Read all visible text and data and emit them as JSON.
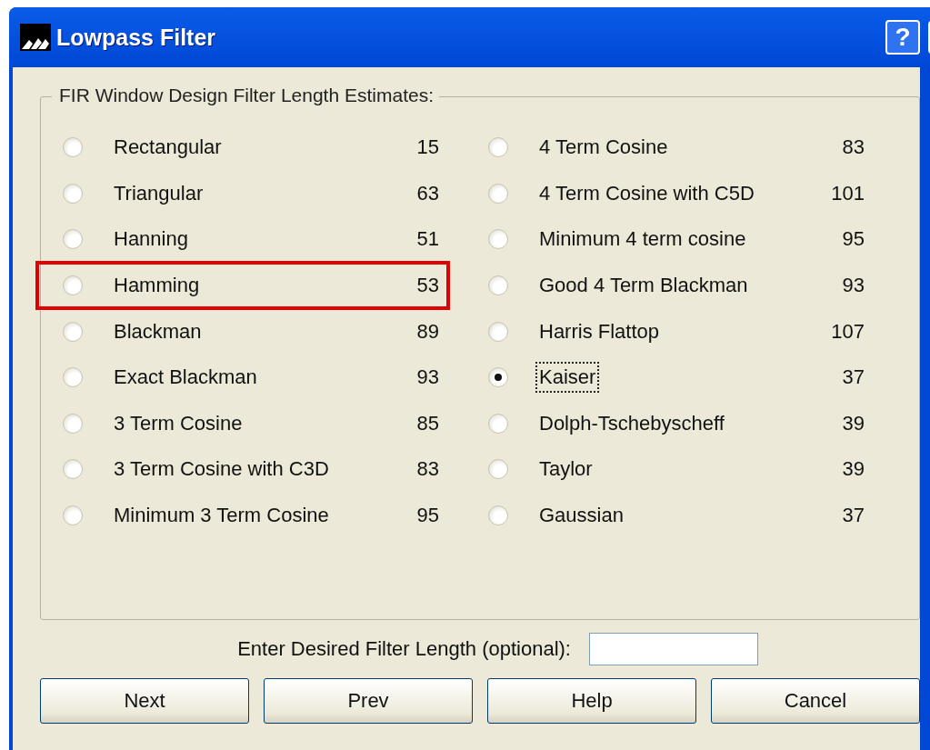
{
  "window": {
    "title": "Lowpass Filter",
    "help_button": "?"
  },
  "group": {
    "title": "FIR Window Design Filter Length Estimates:"
  },
  "windows": [
    {
      "label": "Rectangular",
      "estimate": "15",
      "selected": false,
      "focused": false,
      "highlighted": false
    },
    {
      "label": "Triangular",
      "estimate": "63",
      "selected": false,
      "focused": false,
      "highlighted": false
    },
    {
      "label": "Hanning",
      "estimate": "51",
      "selected": false,
      "focused": false,
      "highlighted": false
    },
    {
      "label": "Hamming",
      "estimate": "53",
      "selected": false,
      "focused": false,
      "highlighted": true
    },
    {
      "label": "Blackman",
      "estimate": "89",
      "selected": false,
      "focused": false,
      "highlighted": false
    },
    {
      "label": "Exact Blackman",
      "estimate": "93",
      "selected": false,
      "focused": false,
      "highlighted": false
    },
    {
      "label": "3 Term Cosine",
      "estimate": "85",
      "selected": false,
      "focused": false,
      "highlighted": false
    },
    {
      "label": "3 Term Cosine with C3D",
      "estimate": "83",
      "selected": false,
      "focused": false,
      "highlighted": false
    },
    {
      "label": "Minimum 3 Term Cosine",
      "estimate": "95",
      "selected": false,
      "focused": false,
      "highlighted": false
    },
    {
      "label": "4 Term Cosine",
      "estimate": "83",
      "selected": false,
      "focused": false,
      "highlighted": false
    },
    {
      "label": "4 Term Cosine with C5D",
      "estimate": "101",
      "selected": false,
      "focused": false,
      "highlighted": false
    },
    {
      "label": "Minimum 4 term cosine",
      "estimate": "95",
      "selected": false,
      "focused": false,
      "highlighted": false
    },
    {
      "label": "Good 4 Term Blackman",
      "estimate": "93",
      "selected": false,
      "focused": false,
      "highlighted": false
    },
    {
      "label": "Harris Flattop",
      "estimate": "107",
      "selected": false,
      "focused": false,
      "highlighted": false
    },
    {
      "label": "Kaiser",
      "estimate": "37",
      "selected": true,
      "focused": true,
      "highlighted": false
    },
    {
      "label": "Dolph-Tschebyscheff",
      "estimate": "39",
      "selected": false,
      "focused": false,
      "highlighted": false
    },
    {
      "label": "Taylor",
      "estimate": "39",
      "selected": false,
      "focused": false,
      "highlighted": false
    },
    {
      "label": "Gaussian",
      "estimate": "37",
      "selected": false,
      "focused": false,
      "highlighted": false
    }
  ],
  "length_field": {
    "label": "Enter Desired Filter Length (optional):"
  },
  "buttons": [
    "Next",
    "Prev",
    "Help",
    "Cancel"
  ]
}
